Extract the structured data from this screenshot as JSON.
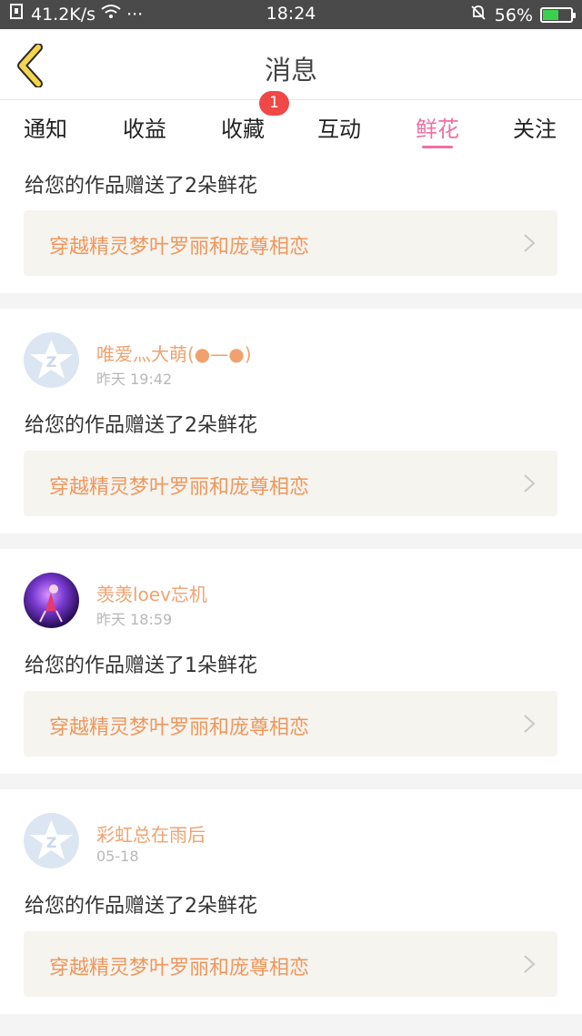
{
  "status": {
    "net_speed": "41.2K/s",
    "dots": "···",
    "time": "18:24",
    "battery_pct": "56%",
    "battery_level": 0.56
  },
  "header": {
    "title": "消息",
    "back_icon": "chevron-left-icon"
  },
  "tabs": [
    {
      "label": "通知"
    },
    {
      "label": "收益"
    },
    {
      "label": "收藏"
    },
    {
      "label": "互动"
    },
    {
      "label": "鲜花"
    },
    {
      "label": "关注"
    }
  ],
  "active_tab": "鲜花",
  "badge": {
    "count": "1"
  },
  "colors": {
    "accent": "#ee6fa3",
    "username": "#f0a26e",
    "link": "#f1965b",
    "badge": "#f04747"
  },
  "items": [
    {
      "message": "给您的作品赠送了2朵鲜花",
      "work": "穿越精灵梦叶罗丽和庞尊相恋"
    },
    {
      "user": "唯爱灬大萌(●—●)",
      "time": "昨天 19:42",
      "message": "给您的作品赠送了2朵鲜花",
      "work": "穿越精灵梦叶罗丽和庞尊相恋"
    },
    {
      "user": "羡羡loev忘机",
      "time": "昨天 18:59",
      "message": "给您的作品赠送了1朵鲜花",
      "work": "穿越精灵梦叶罗丽和庞尊相恋"
    },
    {
      "user": "彩虹总在雨后",
      "time": "05-18",
      "message": "给您的作品赠送了2朵鲜花",
      "work": "穿越精灵梦叶罗丽和庞尊相恋"
    }
  ]
}
